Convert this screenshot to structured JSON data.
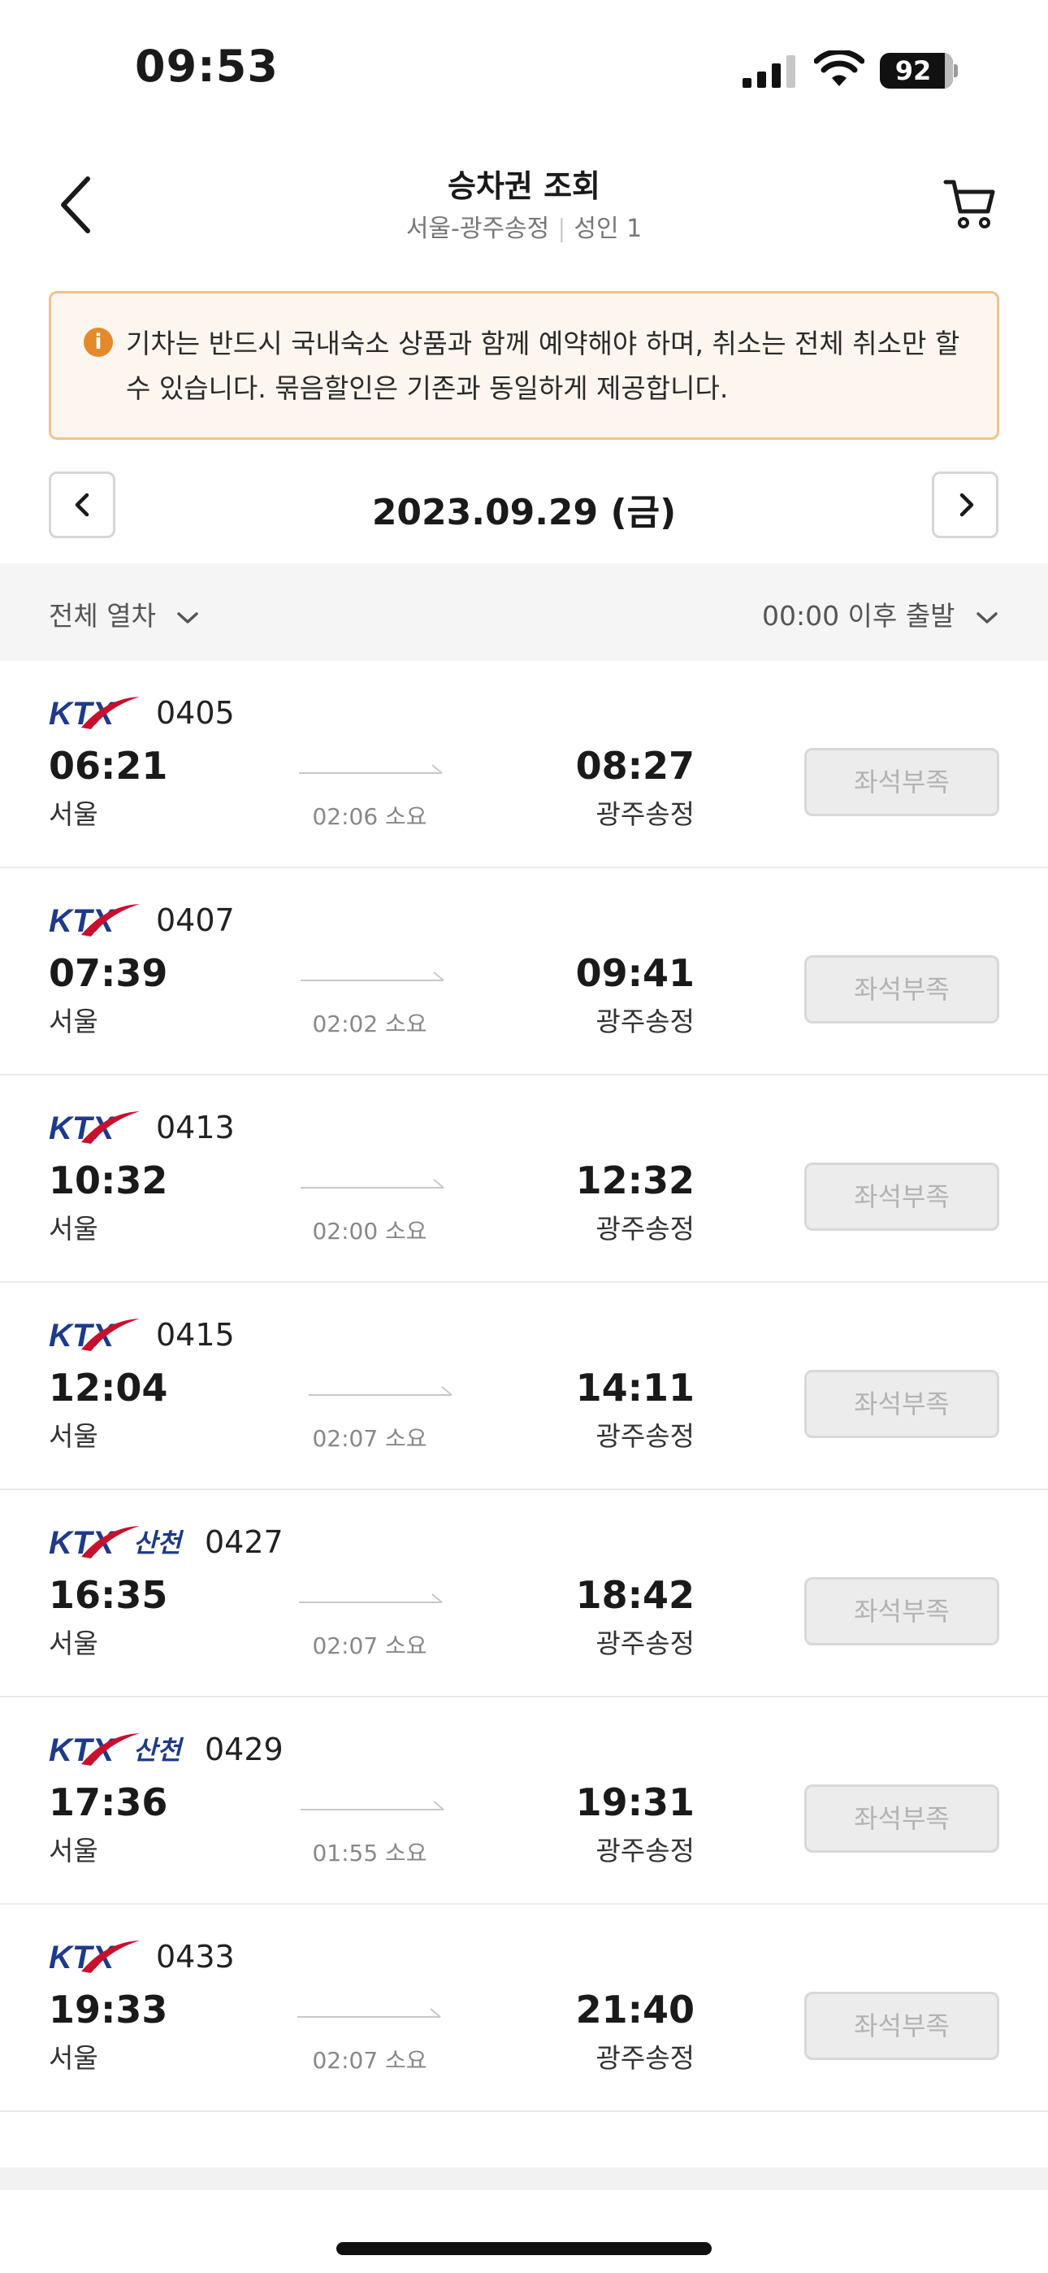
{
  "status_bar": {
    "time": "09:53",
    "battery": "92"
  },
  "header": {
    "title": "승차권 조회",
    "route": "서울-광주송정",
    "separator": "|",
    "passengers": "성인 1"
  },
  "notice": {
    "text": "기차는 반드시 국내숙소 상품과 함께 예약해야 하며, 취소는 전체 취소만 할 수 있습니다. 묶음할인은 기존과 동일하게 제공합니다."
  },
  "date_nav": {
    "date": "2023.09.29 (금)"
  },
  "filters": {
    "train_type": "전체 열차",
    "departure_after": "00:00 이후 출발"
  },
  "trains": [
    {
      "brand": "KTX",
      "number": "0405",
      "dep_time": "06:21",
      "dep_station": "서울",
      "arr_time": "08:27",
      "arr_station": "광주송정",
      "duration": "02:06 소요",
      "status": "좌석부족"
    },
    {
      "brand": "KTX",
      "number": "0407",
      "dep_time": "07:39",
      "dep_station": "서울",
      "arr_time": "09:41",
      "arr_station": "광주송정",
      "duration": "02:02 소요",
      "status": "좌석부족"
    },
    {
      "brand": "KTX",
      "number": "0413",
      "dep_time": "10:32",
      "dep_station": "서울",
      "arr_time": "12:32",
      "arr_station": "광주송정",
      "duration": "02:00 소요",
      "status": "좌석부족"
    },
    {
      "brand": "KTX",
      "number": "0415",
      "dep_time": "12:04",
      "dep_station": "서울",
      "arr_time": "14:11",
      "arr_station": "광주송정",
      "duration": "02:07 소요",
      "status": "좌석부족"
    },
    {
      "brand": "KTX 산천",
      "number": "0427",
      "dep_time": "16:35",
      "dep_station": "서울",
      "arr_time": "18:42",
      "arr_station": "광주송정",
      "duration": "02:07 소요",
      "status": "좌석부족"
    },
    {
      "brand": "KTX 산천",
      "number": "0429",
      "dep_time": "17:36",
      "dep_station": "서울",
      "arr_time": "19:31",
      "arr_station": "광주송정",
      "duration": "01:55 소요",
      "status": "좌석부족"
    },
    {
      "brand": "KTX",
      "number": "0433",
      "dep_time": "19:33",
      "dep_station": "서울",
      "arr_time": "21:40",
      "arr_station": "광주송정",
      "duration": "02:07 소요",
      "status": "좌석부족"
    }
  ],
  "colors": {
    "accent_orange": "#e58a2b",
    "ktx_blue": "#1e3a8a",
    "ktx_red": "#c8102e",
    "disabled_gray": "#ececec"
  }
}
